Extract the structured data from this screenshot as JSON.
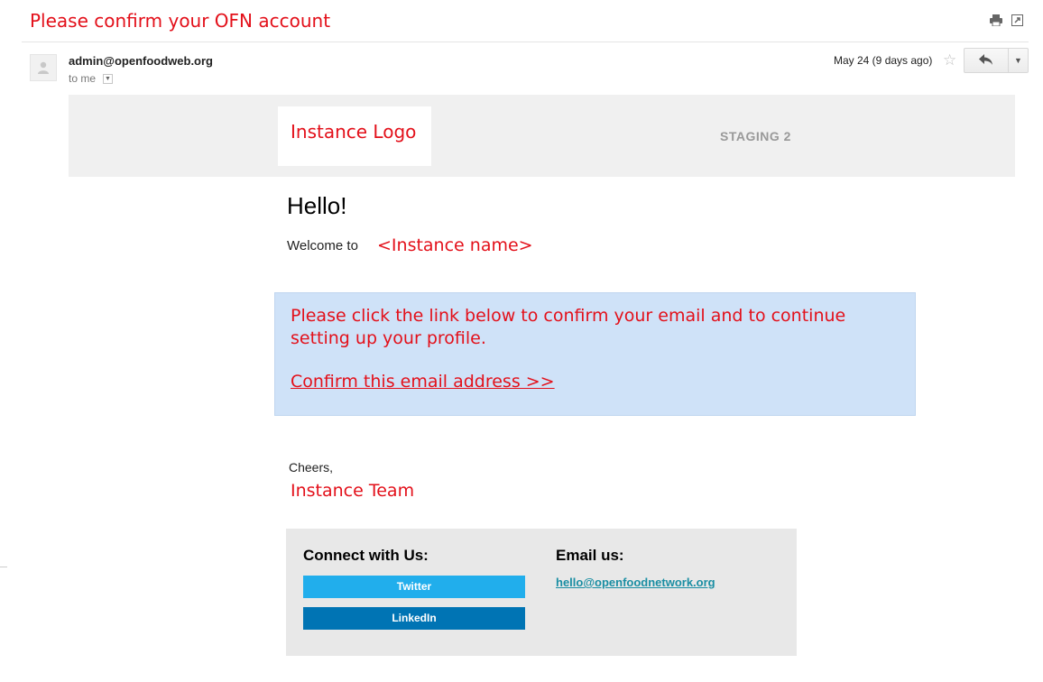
{
  "header": {
    "subject": "Please confirm your OFN account"
  },
  "message": {
    "sender": "admin@openfoodweb.org",
    "recipient": "to me",
    "date": "May 24 (9 days ago)"
  },
  "email": {
    "logo_text": "Instance Logo",
    "environment": "STAGING 2",
    "greeting": "Hello!",
    "welcome_prefix": "Welcome to",
    "instance_name": "<Instance name>",
    "callout_text": "Please click the link below to confirm your email and to continue setting up your profile.",
    "confirm_link": "Confirm this email address >>",
    "signoff": "Cheers,",
    "team": "Instance Team",
    "footer": {
      "connect_title": "Connect with Us:",
      "twitter": "Twitter",
      "linkedin": "LinkedIn",
      "email_title": "Email us:",
      "email_address": "hello@openfoodnetwork.org"
    }
  },
  "colors": {
    "annotation_red": "#e3101a",
    "callout_bg": "#cfe2f8",
    "twitter": "#21aeec",
    "linkedin": "#0074b4"
  },
  "icons": [
    "print-icon",
    "new-window-icon",
    "avatar-icon",
    "star-icon",
    "reply-icon",
    "chevron-down-icon"
  ]
}
